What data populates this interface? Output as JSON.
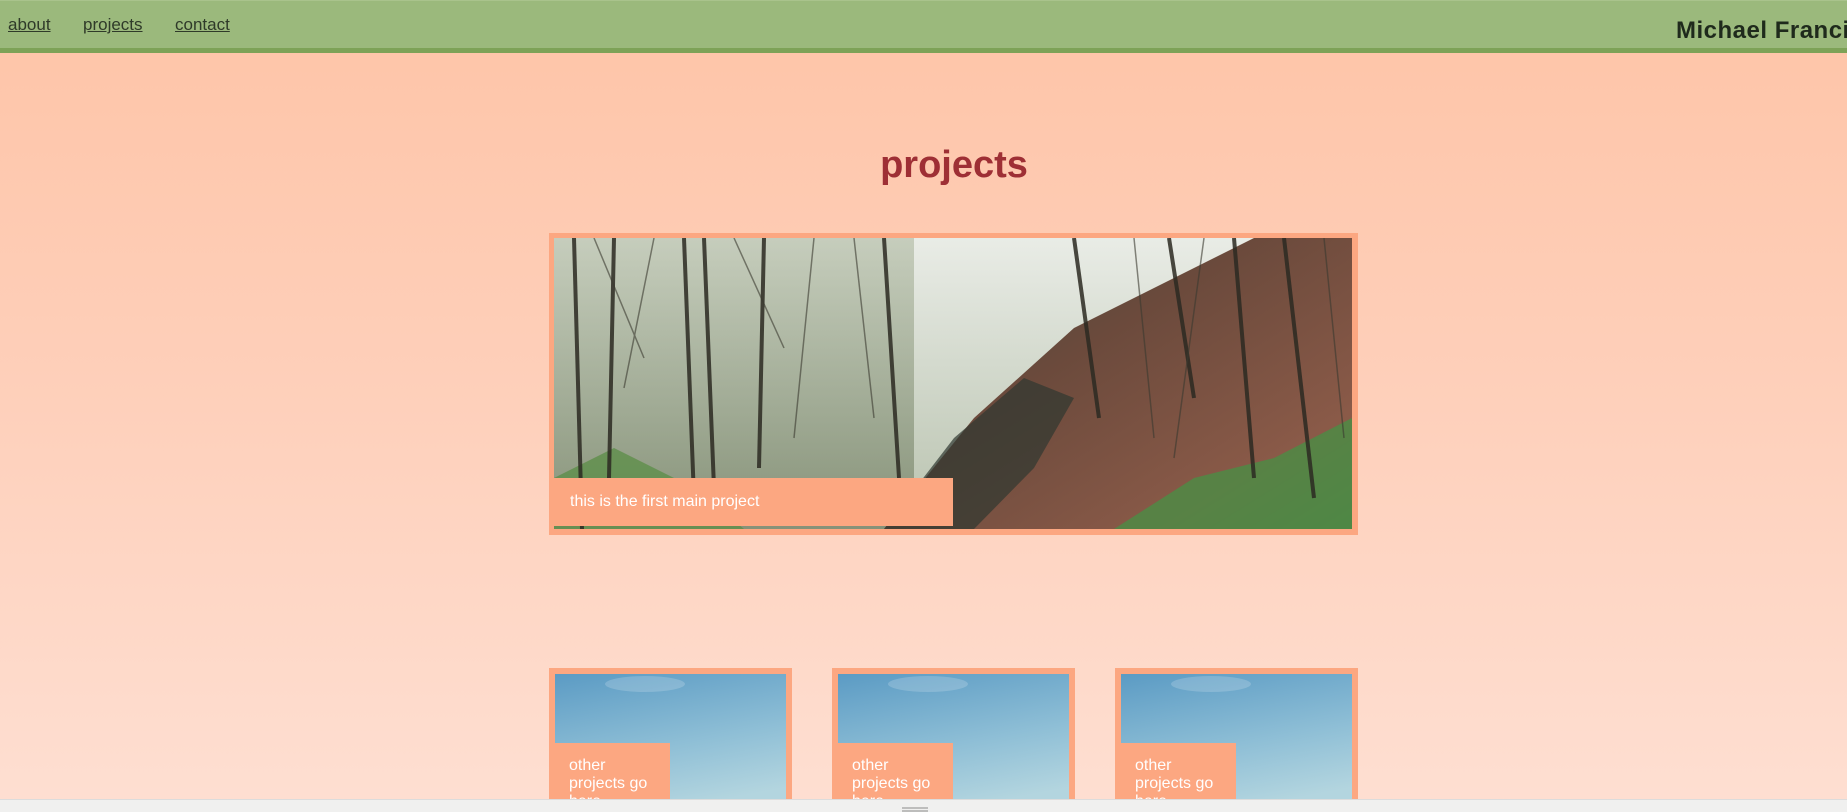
{
  "nav": {
    "links": [
      {
        "label": "about"
      },
      {
        "label": "projects"
      },
      {
        "label": "contact"
      }
    ],
    "brand": "Michael Francis"
  },
  "page": {
    "title": "projects"
  },
  "main_project": {
    "caption": "this is the first main project",
    "image": "forest-hillside-photo"
  },
  "other_projects": [
    {
      "caption": "other projects go here",
      "image": "sky-photo"
    },
    {
      "caption": "other projects go here",
      "image": "sky-photo"
    },
    {
      "caption": "other projects go here",
      "image": "sky-photo"
    }
  ],
  "colors": {
    "nav_bg": "#9bb97c",
    "nav_border": "#7da257",
    "page_bg_top": "#fec4a7",
    "page_bg_bottom": "#fedfd2",
    "title": "#9e2f35",
    "card_frame": "#fca781"
  },
  "icons": {
    "bottom_handle": "grip-lines-icon"
  }
}
